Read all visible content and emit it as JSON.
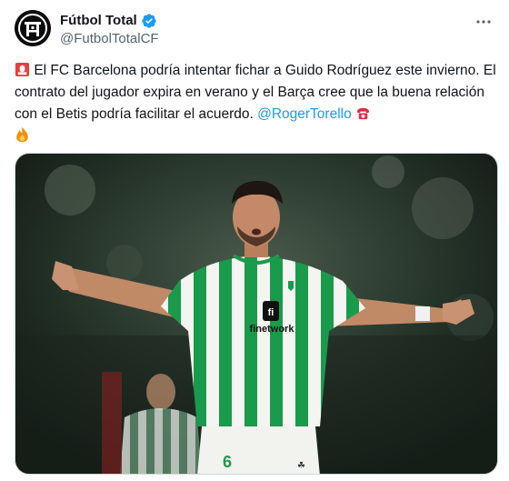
{
  "author": {
    "display_name": "Fútbol Total",
    "handle": "@FutbolTotalCF",
    "avatar_icon": "futbol-total-logo",
    "verified_icon": "verified-badge-icon"
  },
  "more_icon": "more-options-icon",
  "tweet": {
    "siren_emoji": "siren-emoji-icon",
    "text_main": "El FC Barcelona podría intentar fichar a Guido Rodríguez este invierno. El contrato del jugador expira en verano y el Barça cree que la buena relación con el Betis podría facilitar el acuerdo.",
    "mention": "@RogerTorello",
    "phone_emoji": "telephone-emoji-icon",
    "fire_emoji": "fire-emoji-icon"
  },
  "media": {
    "description_icon": "player-photo",
    "shirt_sponsor": "finetwork",
    "shirt_number": "6"
  },
  "colors": {
    "link": "#1d9bf0",
    "verified": "#1d9bf0",
    "secondary_text": "#536471",
    "kit_green": "#1a9a4b"
  }
}
